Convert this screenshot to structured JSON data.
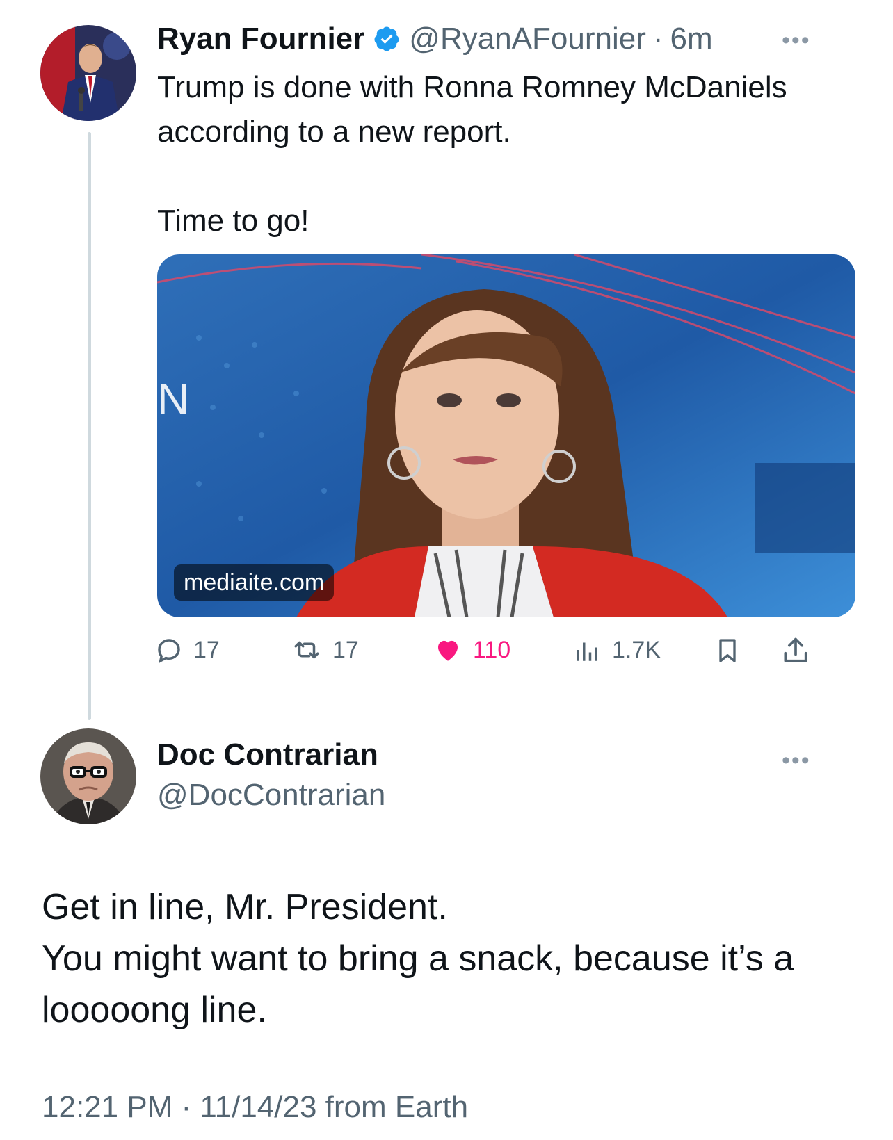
{
  "tweet": {
    "author_name": "Ryan Fournier",
    "handle": "@RyanAFournier",
    "separator": "·",
    "time": "6m",
    "text": "Trump is done with Ronna Romney McDaniels according to a new report.\n\nTime to go!",
    "link_domain": "mediaite.com",
    "actions": {
      "replies": "17",
      "retweets": "17",
      "likes": "110",
      "views": "1.7K"
    },
    "like_color": "#f91880",
    "verified_color": "#1d9bf0"
  },
  "reply": {
    "author_name": "Doc Contrarian",
    "handle": "@DocContrarian",
    "text": "Get in line, Mr. President.\nYou might want to bring a snack, because it’s a looooong line.",
    "timestamp": "12:21 PM · 11/14/23 from Earth"
  },
  "icons": [
    "verified-badge-icon",
    "more-icon",
    "reply-icon",
    "retweet-icon",
    "heart-icon",
    "views-icon",
    "bookmark-icon",
    "share-icon"
  ]
}
